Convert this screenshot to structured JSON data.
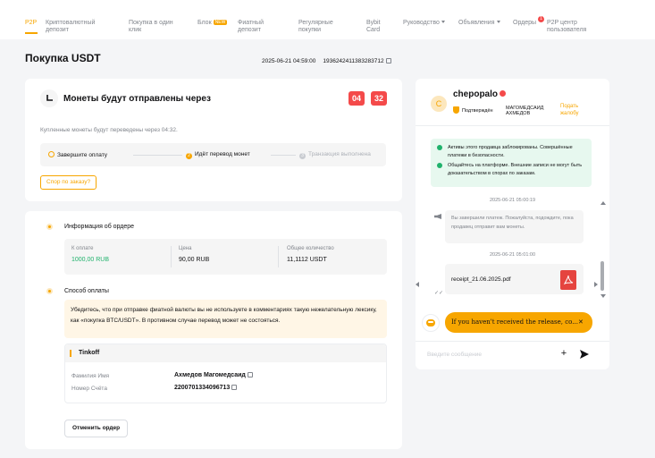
{
  "nav": {
    "items": [
      {
        "label": "P2P"
      },
      {
        "label": "Криптовалютный депозит"
      },
      {
        "label": "Покупка в один клик"
      },
      {
        "label": "Блок",
        "badge": "NEW"
      },
      {
        "label": "Фиатный депозит"
      },
      {
        "label": "Регулярные покупки"
      },
      {
        "label": "Bybit Card"
      },
      {
        "label": "Руководство"
      },
      {
        "label": "Объявления"
      },
      {
        "label": "Ордеры",
        "count": "1"
      },
      {
        "label": "P2P центр пользователя"
      }
    ]
  },
  "header": {
    "title": "Покупка USDT",
    "datetime": "2025-06-21 04:59:00",
    "order_id": "1936242411383283712"
  },
  "timer": {
    "title": "Монеты будут отправлены через",
    "minutes": "04",
    "seconds": "32",
    "description": "Купленные монеты будут переведены через 04:32."
  },
  "steps": [
    {
      "label": "Завершите оплату",
      "state": "done",
      "number": ""
    },
    {
      "label": "Идёт перевод монет",
      "state": "current",
      "number": "2"
    },
    {
      "label": "Транзакция выполнена",
      "state": "pending",
      "number": "3"
    }
  ],
  "dispute_label": "Спор по заказу?",
  "order_info": {
    "title": "Информация об ордере",
    "amount_label": "К оплате",
    "amount": "1000,00 RUB",
    "price_label": "Цена",
    "price": "90,00 RUB",
    "quantity_label": "Общее количество",
    "quantity": "11,1112 USDT"
  },
  "payment": {
    "title": "Способ оплаты",
    "warning": "Убедитесь, что при отправке фиатной валюты вы не используете в комментариях такую нежелательную лексику, как «покупка BTC/USDT». В противном случае перевод может не состояться.",
    "method": "Tinkoff",
    "name_label": "Фамилия Имя",
    "name": "Ахмедов Магомедсаид",
    "account_label": "Номер Счёта",
    "account": "2200701334096713"
  },
  "cancel_label": "Отменить ордер",
  "chat": {
    "avatar_letter": "C",
    "seller": "chepopalo",
    "verified_label": "Подтверждён",
    "verified_name": "МАГОМЕДСАИД АХМЕДОВ",
    "complain_label": "Подать жалобу",
    "notice_1": "Активы этого продавца заблокированы. Совершённые платежи в безопасности.",
    "notice_2": "Общайтесь на платформе. Внешние записи не могут быть доказательством в спорах по заказам.",
    "ts1": "2025-06-21 05:00:19",
    "system_message": "Вы завершили платеж. Пожалуйста, подождите, пока продавец отправит вам монеты.",
    "ts2": "2025-06-21 05:01:00",
    "file_name": "receipt_21.06.2025.pdf",
    "bot_message": "If you haven't received the release, co...",
    "input_placeholder": "Введите сообщение"
  },
  "colors": {
    "accent": "#f7a600",
    "timer_red": "#f44a4a",
    "green": "#20b26c"
  }
}
